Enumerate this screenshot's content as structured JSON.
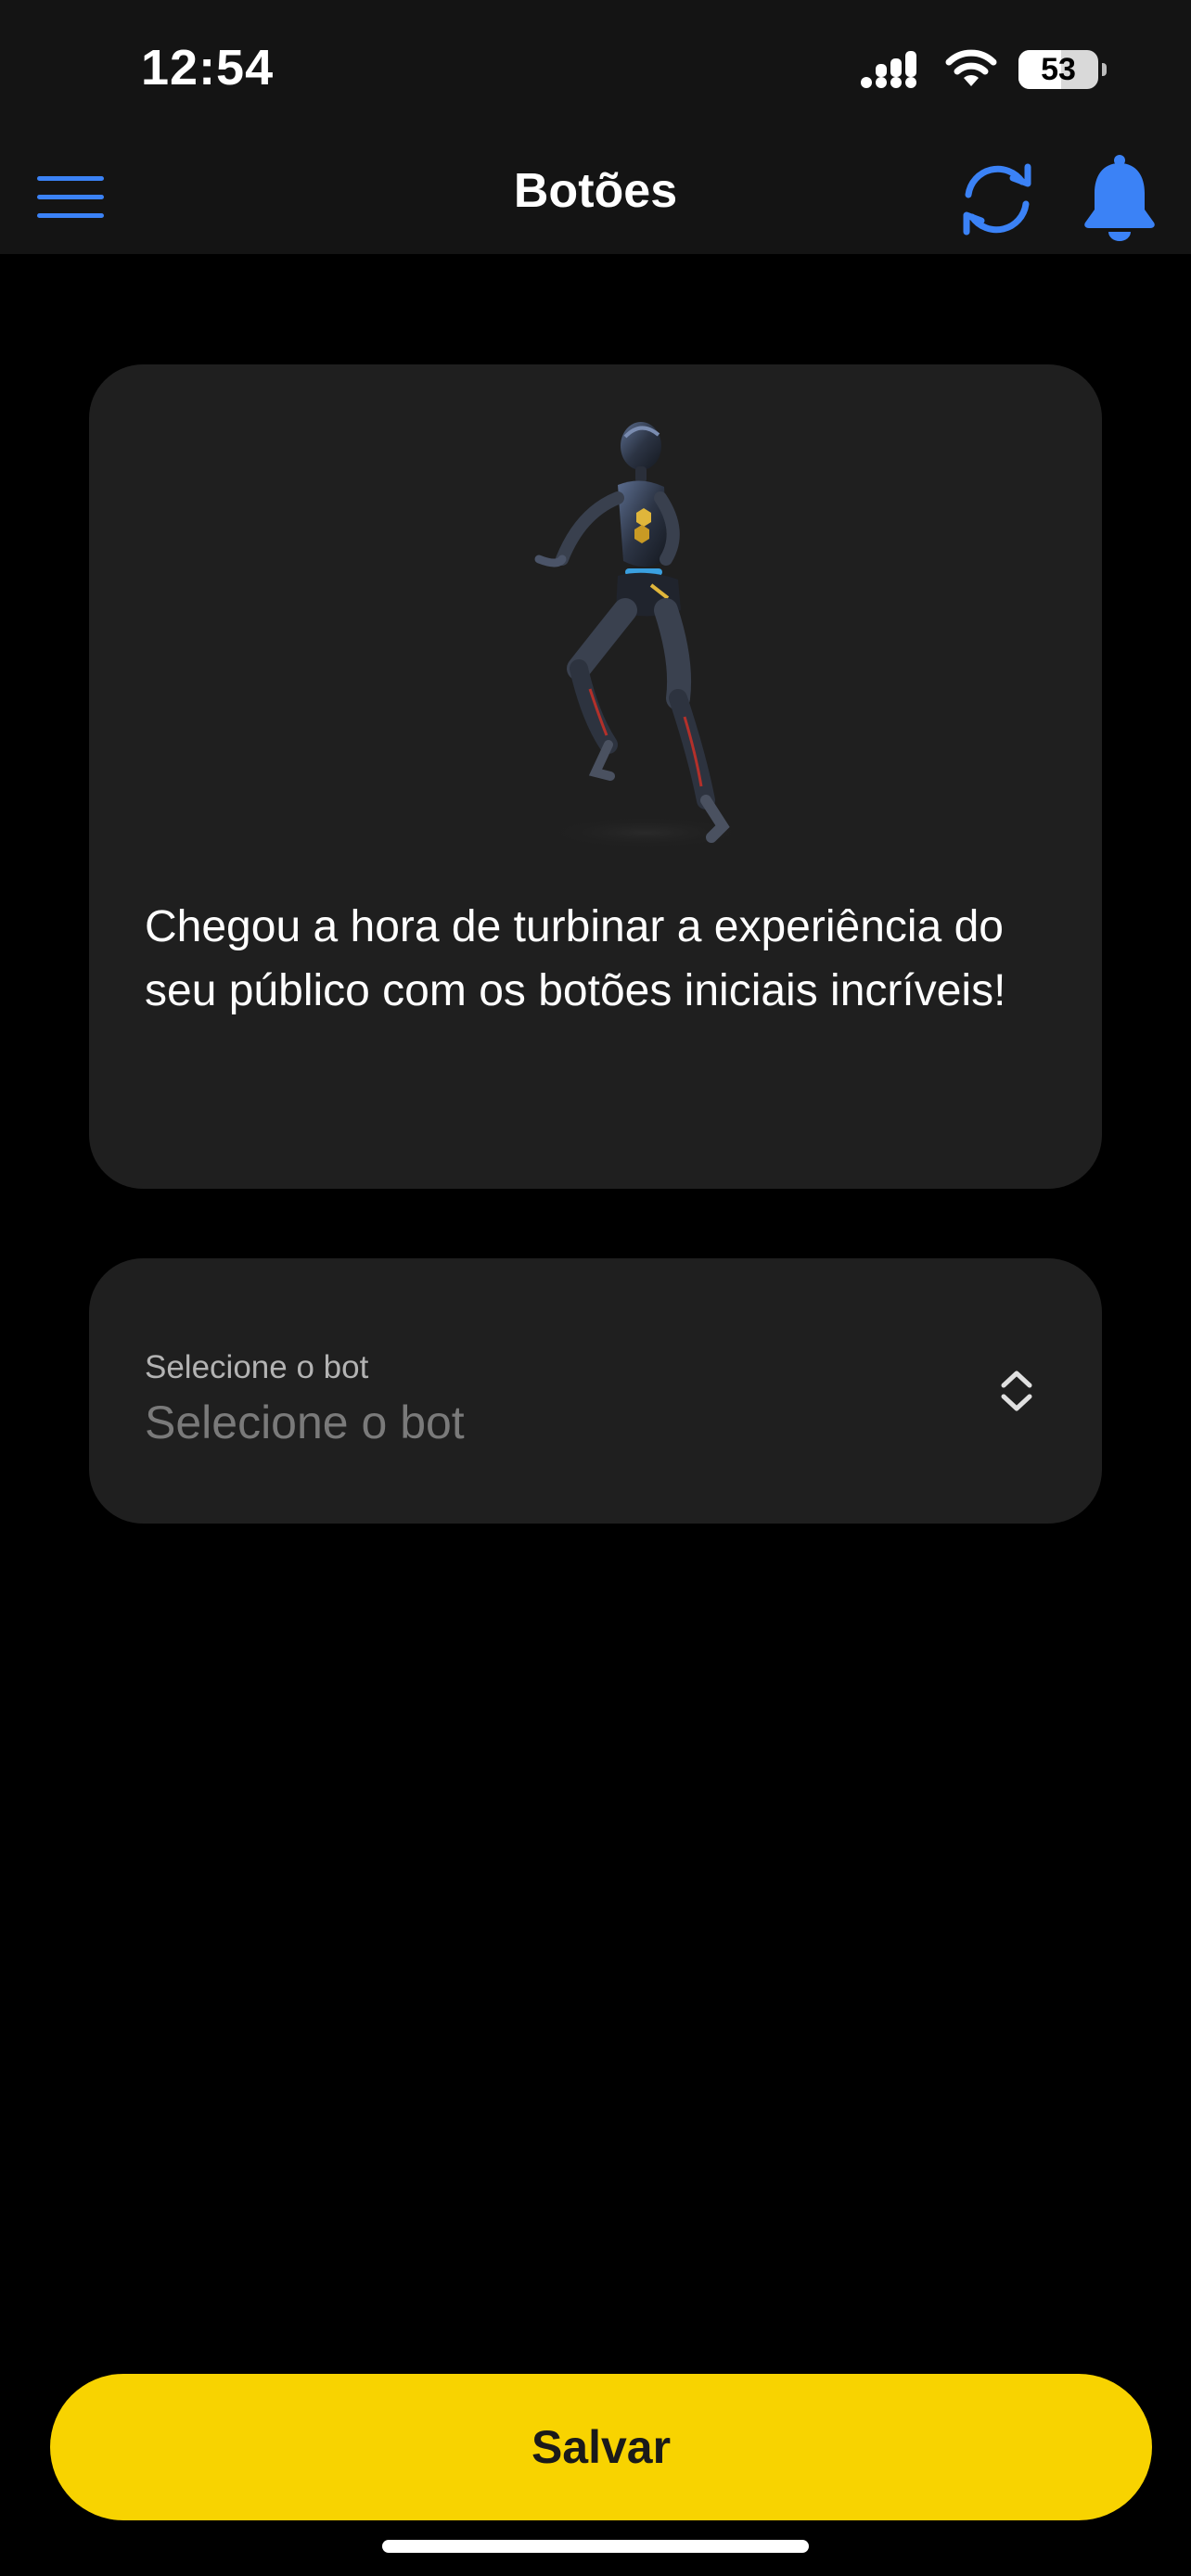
{
  "status_bar": {
    "time": "12:54",
    "battery_level": "53",
    "battery_fraction": 0.53,
    "icons": [
      "cellular-signal-icon",
      "wifi-icon",
      "battery-icon"
    ]
  },
  "header": {
    "title": "Botões",
    "left_icon": "hamburger-menu-icon",
    "right_icons": [
      "refresh-icon",
      "bell-icon"
    ]
  },
  "hero": {
    "illustration": "robot-illustration",
    "text": "Chegou a hora de turbinar a experiência do seu público com os botões iniciais incríveis!"
  },
  "bot_select": {
    "label": "Selecione o bot",
    "value": "Selecione o bot",
    "icon": "chevron-up-down-icon"
  },
  "footer": {
    "save_label": "Salvar"
  },
  "colors": {
    "accent_blue": "#3b82f6",
    "save_yellow": "#f8d300",
    "card_bg": "#1f1f1f",
    "header_bg": "#141414",
    "page_bg": "#000000"
  }
}
